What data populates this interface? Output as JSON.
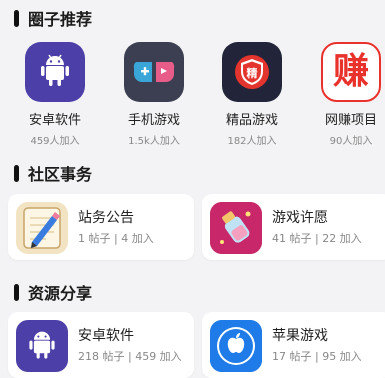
{
  "sections": {
    "circles_title": "圈子推荐",
    "community_title": "社区事务",
    "resources_title": "资源分享"
  },
  "circles": [
    {
      "name": "安卓软件",
      "members": "459人加入",
      "icon": "android-icon",
      "color": "#4c3fa8"
    },
    {
      "name": "手机游戏",
      "members": "1.5k人加入",
      "icon": "gamepad-icon",
      "color": "#3c3f52"
    },
    {
      "name": "精品游戏",
      "members": "182人加入",
      "icon": "shield-badge-icon",
      "color": "#22243a"
    },
    {
      "name": "网赚项目",
      "members": "90人加入",
      "icon": "earn-icon",
      "color": "#e8322b",
      "icon_text": "赚"
    }
  ],
  "community": [
    {
      "title": "站务公告",
      "stats": "1 帖子 | 4 加入",
      "icon": "notepad-pencil-icon"
    },
    {
      "title": "游戏许愿",
      "stats": "41 帖子 | 22 加入",
      "icon": "wish-bottle-icon"
    }
  ],
  "resources": [
    {
      "title": "安卓软件",
      "stats": "218 帖子 | 459 加入",
      "icon": "android-icon"
    },
    {
      "title": "苹果游戏",
      "stats": "17 帖子 | 95 加入",
      "icon": "apple-icon"
    }
  ],
  "shield_text": "精"
}
